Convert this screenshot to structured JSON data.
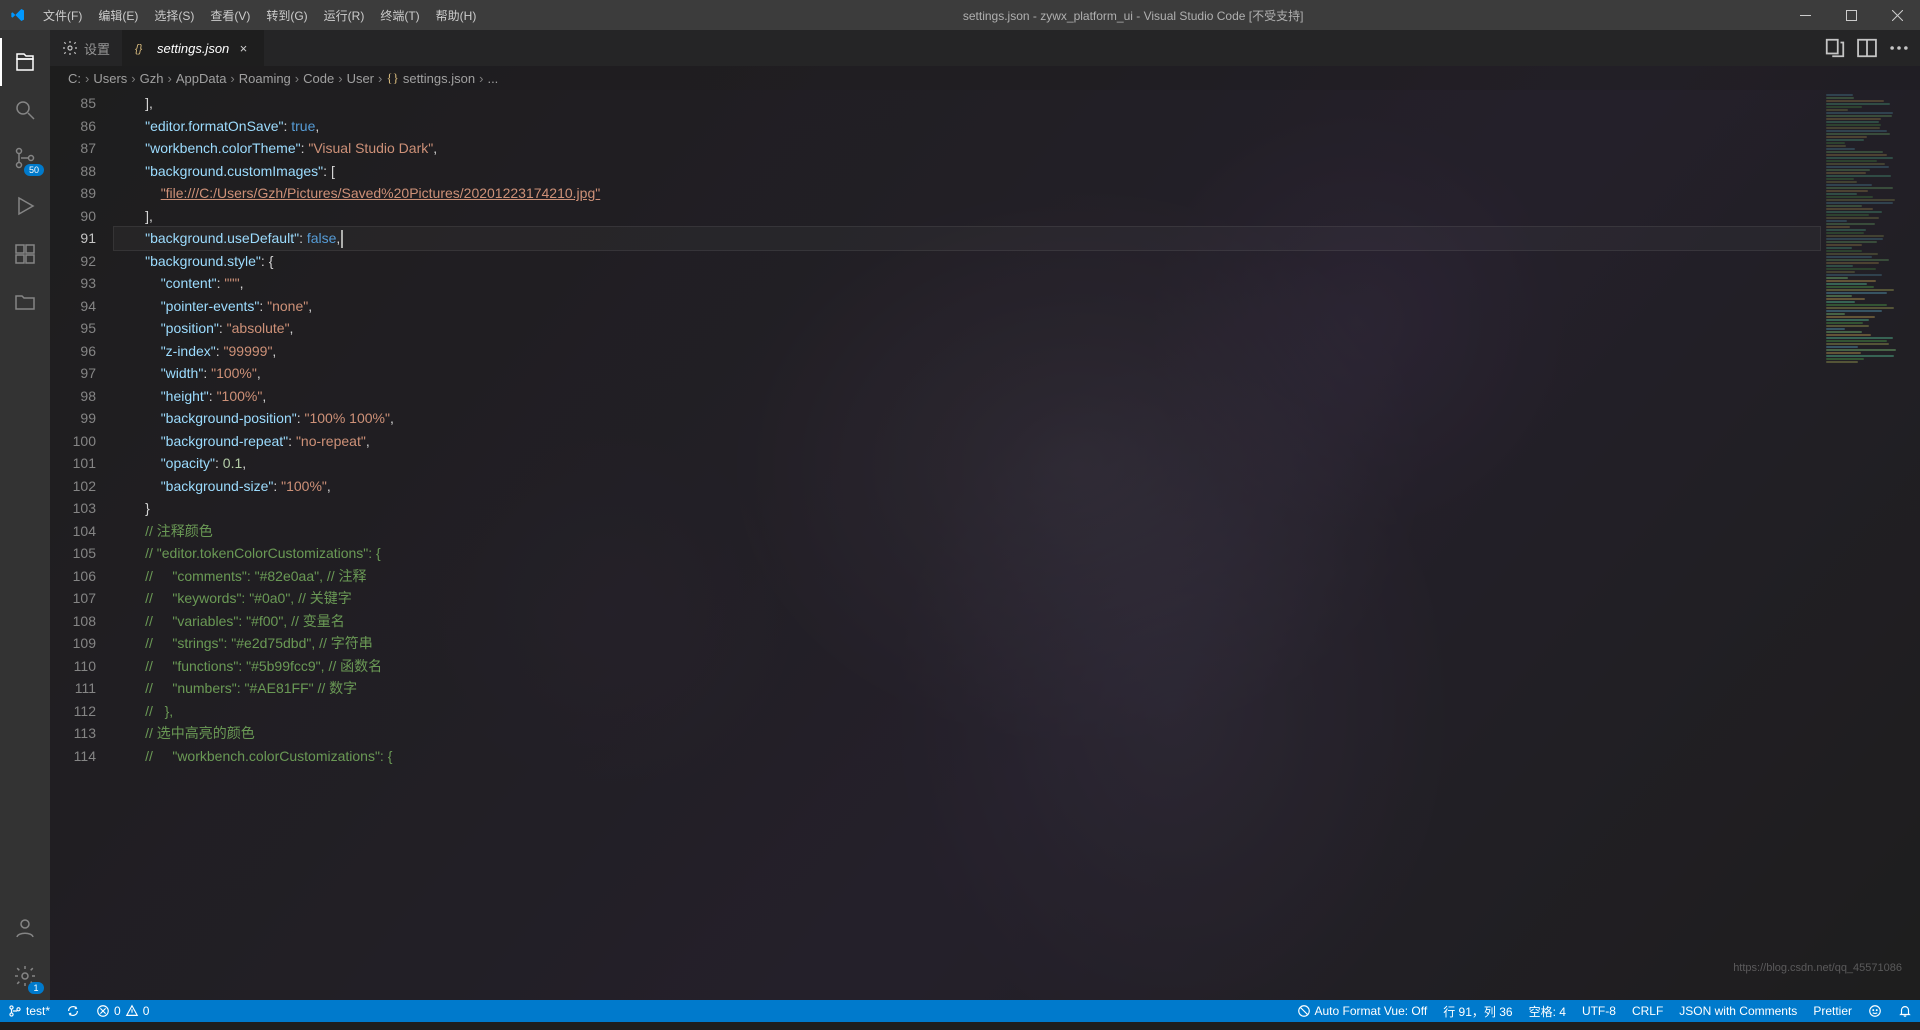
{
  "window": {
    "title": "settings.json - zywx_platform_ui - Visual Studio Code [不受支持]"
  },
  "menu": {
    "file": "文件(F)",
    "edit": "编辑(E)",
    "select": "选择(S)",
    "view": "查看(V)",
    "goto": "转到(G)",
    "run": "运行(R)",
    "terminal": "终端(T)",
    "help": "帮助(H)"
  },
  "activity": {
    "scm_badge": "50",
    "manage_badge": "1"
  },
  "tabs": {
    "settings": "设置",
    "file": "settings.json"
  },
  "breadcrumbs": {
    "c": "C:",
    "users": "Users",
    "gzh": "Gzh",
    "appdata": "AppData",
    "roaming": "Roaming",
    "code": "Code",
    "user": "User",
    "file": "settings.json",
    "ellipsis": "..."
  },
  "lines": {
    "start": 85,
    "count": 30,
    "current": 91
  },
  "code": {
    "l85": "],",
    "k86": "\"editor.formatOnSave\"",
    "v86": "true",
    "k87": "\"workbench.colorTheme\"",
    "v87": "\"Visual Studio Dark\"",
    "k88": "\"background.customImages\"",
    "b88": "[",
    "v89": "\"file:///C:/Users/Gzh/Pictures/Saved%20Pictures/20201223174210.jpg\"",
    "l90": "],",
    "k91": "\"background.useDefault\"",
    "v91": "false",
    "k92": "\"background.style\"",
    "b92": "{",
    "k93": "\"content\"",
    "v93": "\"''\"",
    "k94": "\"pointer-events\"",
    "v94": "\"none\"",
    "k95": "\"position\"",
    "v95": "\"absolute\"",
    "k96": "\"z-index\"",
    "v96": "\"99999\"",
    "k97": "\"width\"",
    "v97": "\"100%\"",
    "k98": "\"height\"",
    "v98": "\"100%\"",
    "k99": "\"background-position\"",
    "v99": "\"100% 100%\"",
    "k100": "\"background-repeat\"",
    "v100": "\"no-repeat\"",
    "k101": "\"opacity\"",
    "v101": "0.1",
    "k102": "\"background-size\"",
    "v102": "\"100%\"",
    "l103": "}",
    "c104": "// 注释颜色",
    "c105": "// \"editor.tokenColorCustomizations\": {",
    "c106a": "//     \"comments\": \"#82e0aa\", ",
    "c106b": "// 注释",
    "c107a": "//     \"keywords\": \"#0a0\", ",
    "c107b": "// 关键字",
    "c108a": "//     \"variables\": \"#f00\", ",
    "c108b": "// 变量名",
    "c109a": "//     \"strings\": \"#e2d75dbd\", ",
    "c109b": "// 字符串",
    "c110a": "//     \"functions\": \"#5b99fcc9\", ",
    "c110b": "// 函数名",
    "c111a": "//     \"numbers\": \"#AE81FF\" ",
    "c111b": "// 数字",
    "c112": "//   },",
    "c113": "// 选中高亮的颜色",
    "c114": "//     \"workbench.colorCustomizations\": {"
  },
  "status": {
    "branch": "test*",
    "errors": "0",
    "warnings": "0",
    "autoformat": "Auto Format Vue: Off",
    "cursor": "行 91，列 36",
    "spaces": "空格: 4",
    "encoding": "UTF-8",
    "eol": "CRLF",
    "lang": "JSON with Comments",
    "prettier": "Prettier"
  },
  "watermark": "https://blog.csdn.net/qq_45571086"
}
